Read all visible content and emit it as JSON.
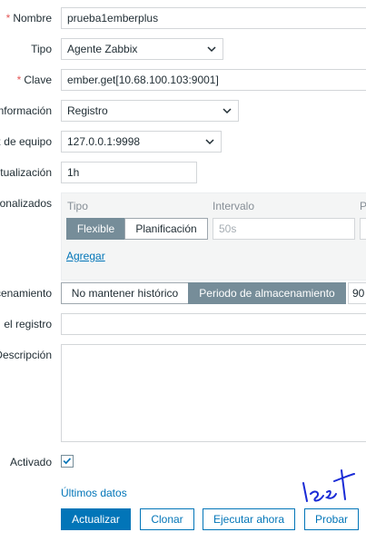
{
  "form": {
    "name": {
      "label": "Nombre",
      "value": "prueba1emberplus",
      "required": true
    },
    "type": {
      "label": "Tipo",
      "value": "Agente Zabbix"
    },
    "key": {
      "label": "Clave",
      "value": "ember.get[10.68.100.103:9001]",
      "required": true
    },
    "info_type": {
      "label": "nformación",
      "value": "Registro"
    },
    "host_interface": {
      "label": "z de equipo",
      "value": "127.0.0.1:9998"
    },
    "update_interval": {
      "label": "ctualización",
      "value": "1h"
    },
    "custom_intervals": {
      "label": "onalizados",
      "col_type": "Tipo",
      "col_interval": "Intervalo",
      "col_period": "P",
      "flexible_label": "Flexible",
      "scheduling_label": "Planificación",
      "interval_placeholder": "50s",
      "add_link": "Agregar"
    },
    "history": {
      "label": "cenamiento",
      "option_no_keep": "No mantener histórico",
      "option_period": "Periodo de almacenamiento",
      "value": "90"
    },
    "log_time_format": {
      "label": "el registro",
      "value": ""
    },
    "description": {
      "label": "Descripción",
      "value": ""
    },
    "enabled": {
      "label": "Activado",
      "checked": true
    }
  },
  "latest_data_link": "Últimos datos",
  "actions": {
    "update": "Actualizar",
    "clone": "Clonar",
    "execute_now": "Ejecutar ahora",
    "test": "Probar"
  },
  "colors": {
    "primary": "#0275b8",
    "required": "#e45959",
    "segment_active": "#768d99",
    "ink_scribble": "#1a2bd6"
  }
}
